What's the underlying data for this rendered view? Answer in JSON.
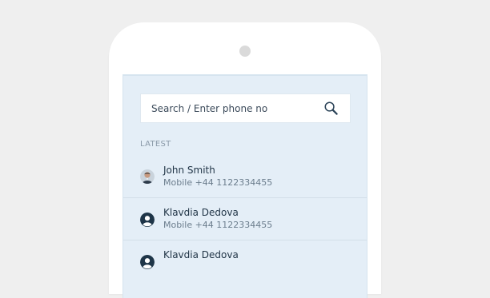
{
  "search": {
    "placeholder": "Search / Enter phone no",
    "icon": "search-icon"
  },
  "section": {
    "label": "LATEST"
  },
  "contacts": [
    {
      "name": "John Smith",
      "detail": "Mobile +44 1122334455",
      "avatar": "photo-avatar"
    },
    {
      "name": "Klavdia Dedova",
      "detail": "Mobile +44 1122334455",
      "avatar": "user-icon"
    },
    {
      "name": "Klavdia Dedova",
      "avatar": "user-icon"
    }
  ],
  "colors": {
    "background": "#efefef",
    "phone": "#ffffff",
    "screen": "#e4eef7",
    "text_primary": "#1f3345",
    "text_secondary": "#6b7d8d",
    "icon": "#1e3548"
  }
}
